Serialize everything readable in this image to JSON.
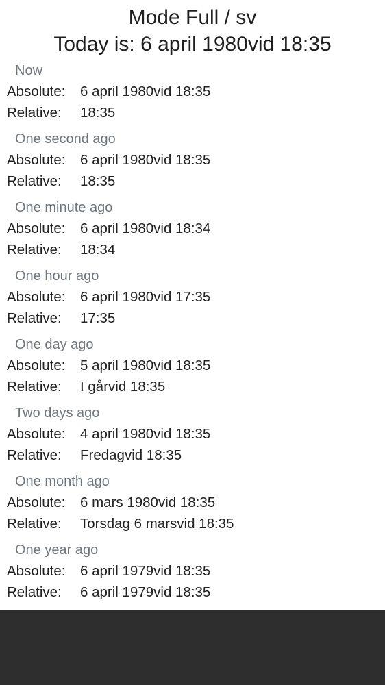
{
  "header": {
    "title": "Mode Full / sv",
    "today_prefix": "Today is: ",
    "today_value": "6 april 1980vid 18:35"
  },
  "labels": {
    "absolute": "Absolute:",
    "relative": "Relative:"
  },
  "entries": [
    {
      "label": "Now",
      "absolute": "6 april 1980vid 18:35",
      "relative": "18:35"
    },
    {
      "label": "One second ago",
      "absolute": "6 april 1980vid 18:35",
      "relative": "18:35"
    },
    {
      "label": "One minute ago",
      "absolute": "6 april 1980vid 18:34",
      "relative": "18:34"
    },
    {
      "label": "One hour ago",
      "absolute": "6 april 1980vid 17:35",
      "relative": "17:35"
    },
    {
      "label": "One day ago",
      "absolute": "5 april 1980vid 18:35",
      "relative": "I gårvid 18:35"
    },
    {
      "label": "Two days ago",
      "absolute": "4 april 1980vid 18:35",
      "relative": "Fredagvid 18:35"
    },
    {
      "label": "One month ago",
      "absolute": "6 mars 1980vid 18:35",
      "relative": "Torsdag 6 marsvid 18:35"
    },
    {
      "label": "One year ago",
      "absolute": "6 april 1979vid 18:35",
      "relative": "6 april 1979vid 18:35"
    }
  ]
}
